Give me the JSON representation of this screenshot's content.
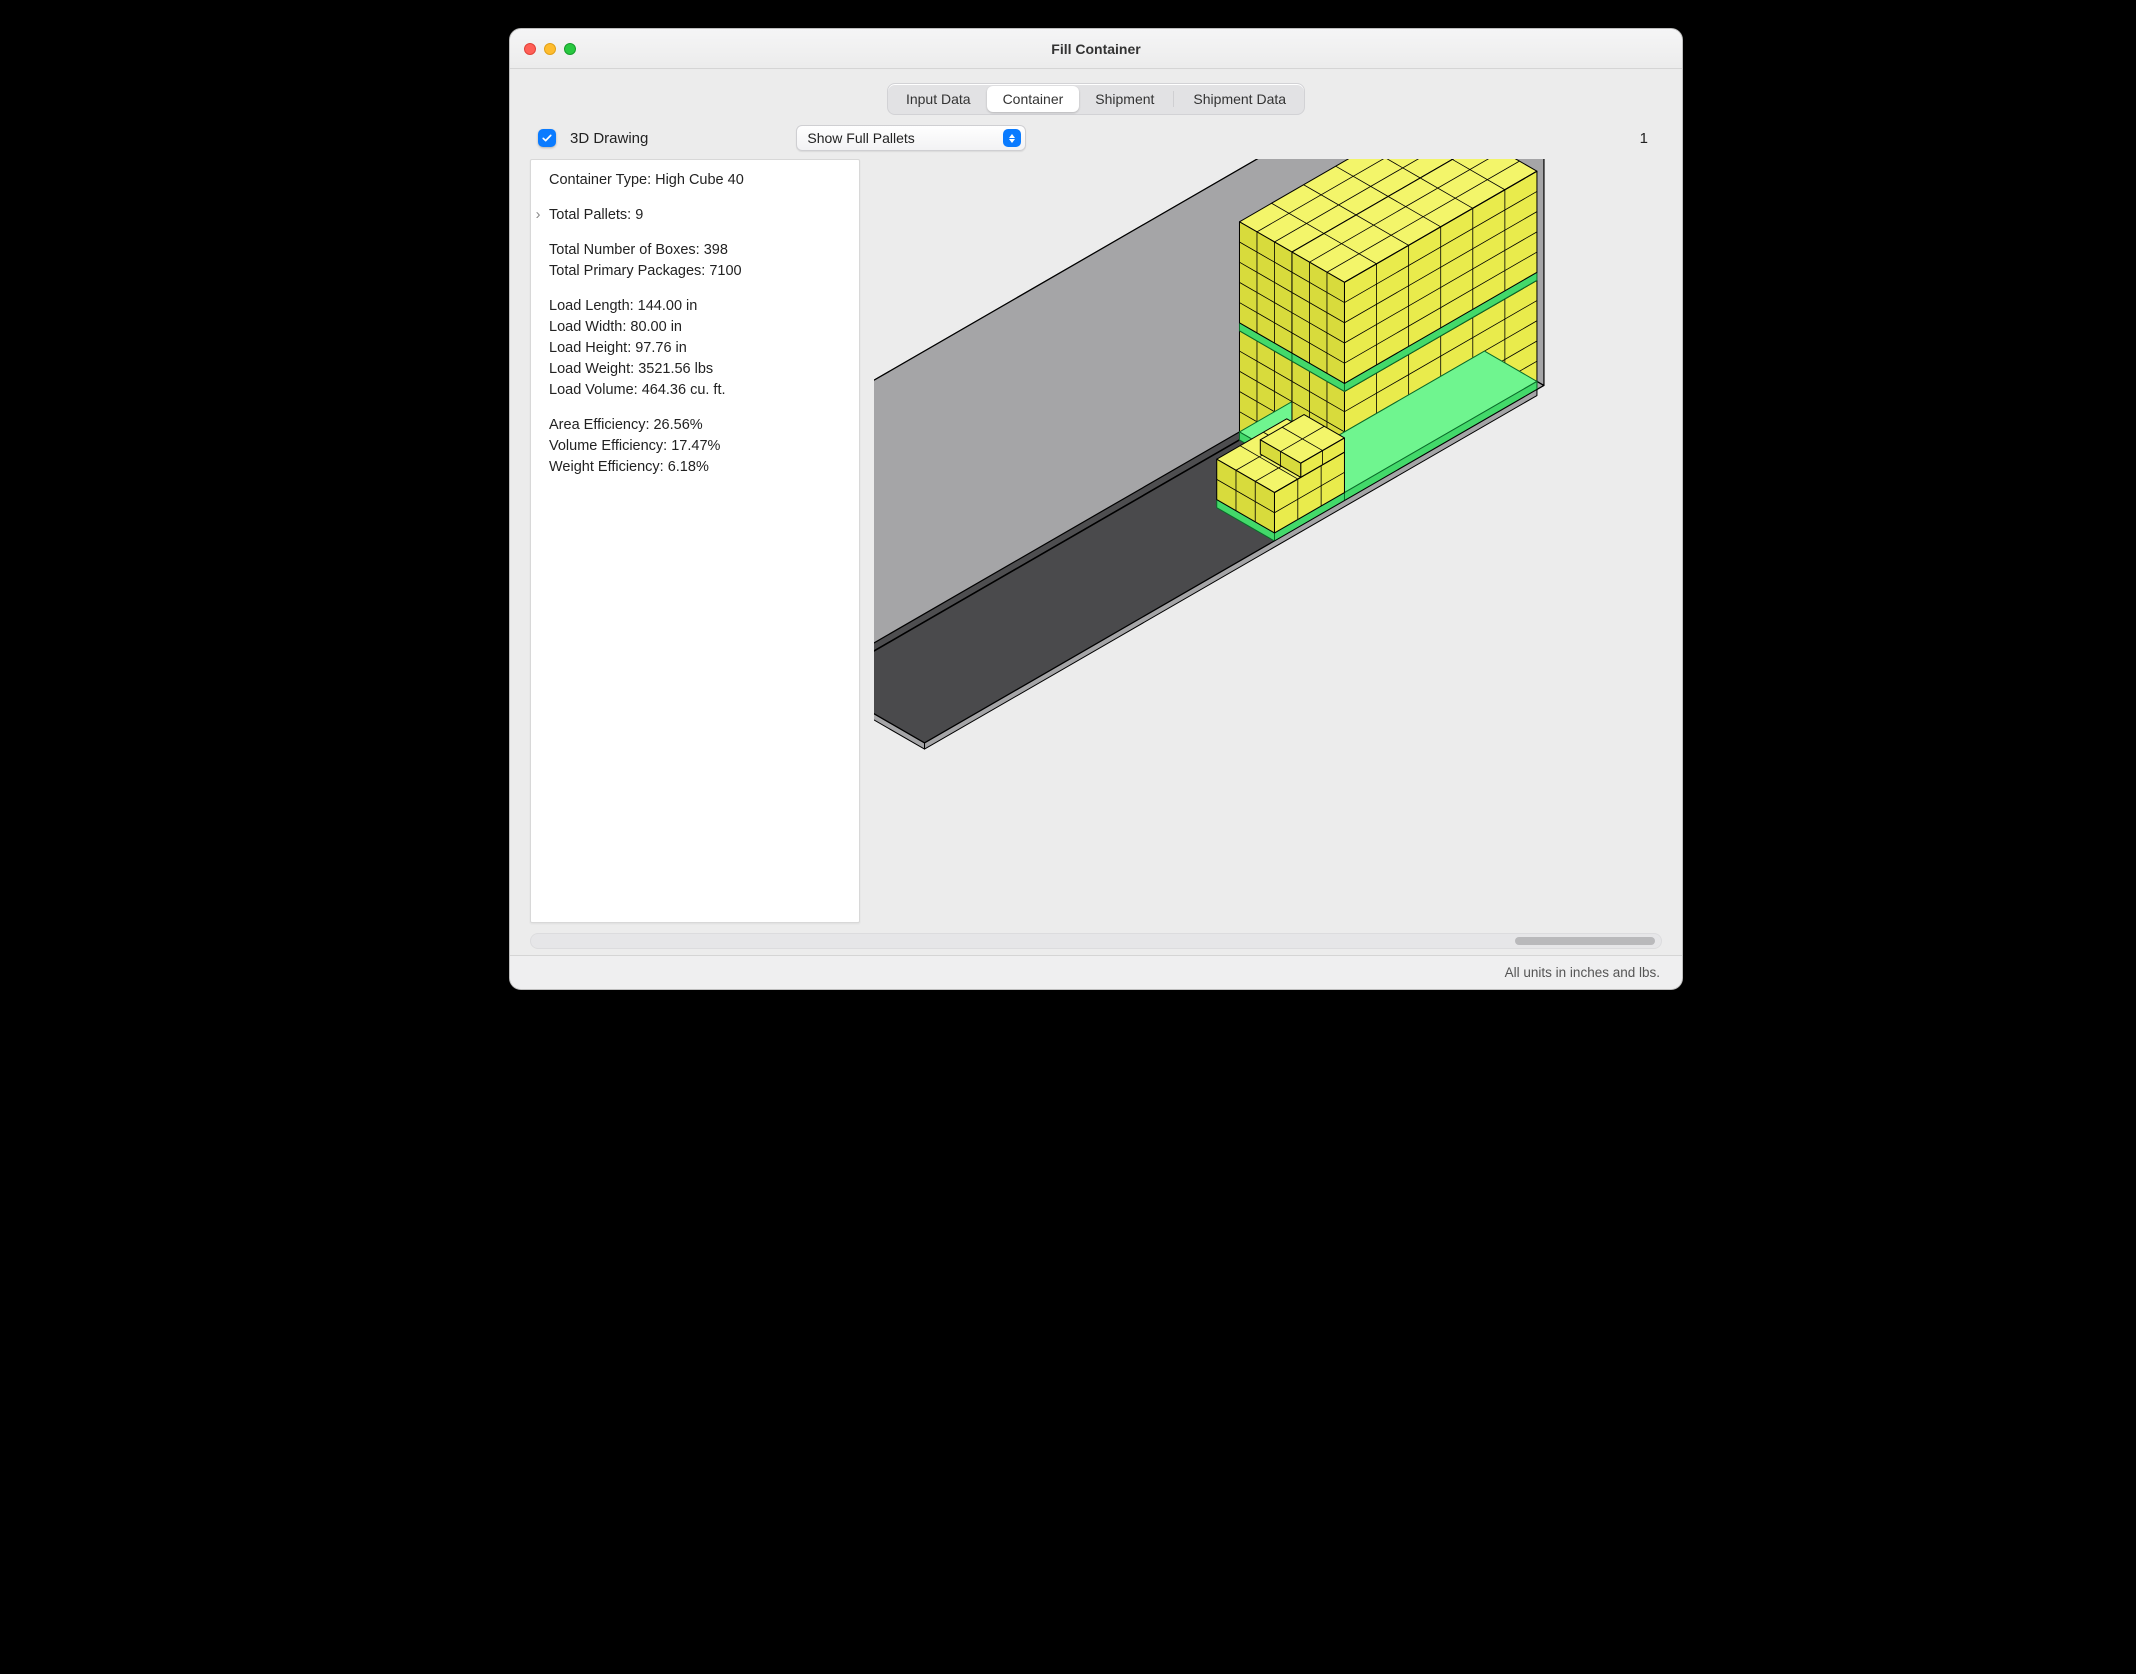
{
  "window": {
    "title": "Fill Container"
  },
  "tabs": [
    "Input Data",
    "Container",
    "Shipment",
    "Shipment Data"
  ],
  "active_tab_index": 1,
  "toolbar": {
    "drawing_checkbox_label": "3D Drawing",
    "drawing_checked": true,
    "dropdown_selected": "Show Full Pallets",
    "counter": "1"
  },
  "info": {
    "container_type_label": "Container Type:",
    "container_type_value": "High Cube 40",
    "total_pallets_label": "Total Pallets:",
    "total_pallets_value": "9",
    "total_boxes_label": "Total Number of Boxes:",
    "total_boxes_value": "398",
    "total_primary_label": "Total Primary Packages:",
    "total_primary_value": "7100",
    "load_length_label": "Load Length:",
    "load_length_value": "144.00 in",
    "load_width_label": "Load Width:",
    "load_width_value": "80.00 in",
    "load_height_label": "Load Height:",
    "load_height_value": "97.76 in",
    "load_weight_label": "Load Weight:",
    "load_weight_value": "3521.56 lbs",
    "load_volume_label": "Load Volume:",
    "load_volume_value": "464.36 cu. ft.",
    "area_eff_label": "Area Efficiency:",
    "area_eff_value": "26.56%",
    "vol_eff_label": "Volume Efficiency:",
    "vol_eff_value": "17.47%",
    "wt_eff_label": "Weight Efficiency:",
    "wt_eff_value": "6.18%"
  },
  "footer": {
    "units_note": "All units in inches and lbs."
  }
}
